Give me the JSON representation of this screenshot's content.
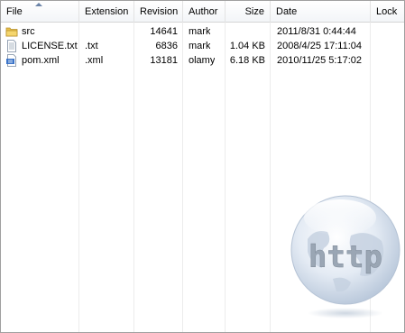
{
  "columns": {
    "file": "File",
    "extension": "Extension",
    "revision": "Revision",
    "author": "Author",
    "size": "Size",
    "date": "Date",
    "lock": "Lock"
  },
  "rows": [
    {
      "name": "src",
      "icon": "folder-icon",
      "extension": "",
      "revision": "14641",
      "author": "mark",
      "size": "",
      "date": "2011/8/31 0:44:44"
    },
    {
      "name": "LICENSE.txt",
      "icon": "text-file-icon",
      "extension": ".txt",
      "revision": "6836",
      "author": "mark",
      "size": "1.04 KB",
      "date": "2008/4/25 17:11:04"
    },
    {
      "name": "pom.xml",
      "icon": "xml-file-icon",
      "extension": ".xml",
      "revision": "13181",
      "author": "olamy",
      "size": "6.18 KB",
      "date": "2010/11/25 5:17:02"
    }
  ],
  "watermark": {
    "text": "http",
    "icon": "globe-icon"
  }
}
